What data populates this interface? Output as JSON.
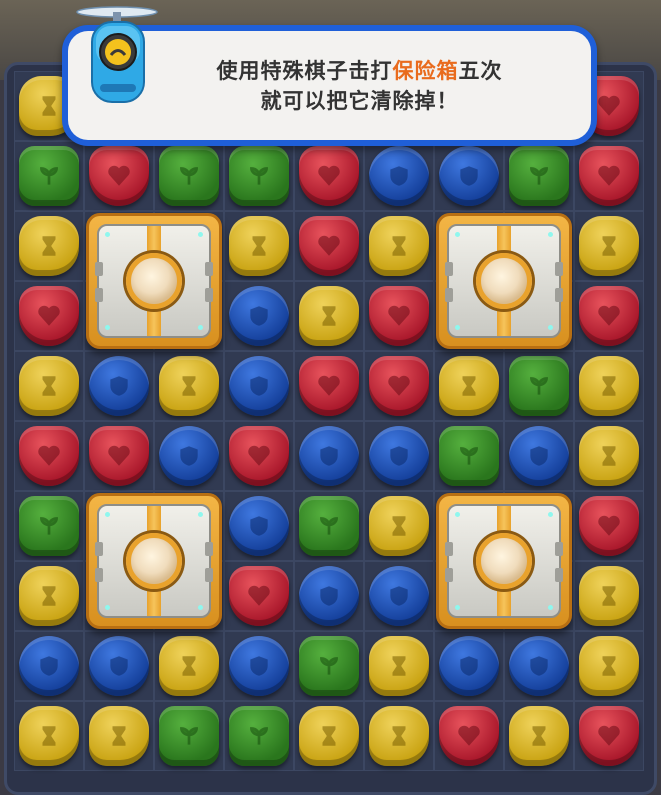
{
  "tooltip": {
    "line1_before": "使用特殊棋子击打",
    "line1_highlight": "保险箱",
    "line1_after": "五次",
    "line2": "就可以把它清除掉！"
  },
  "colors": {
    "highlight": "#e96b1d",
    "banner_border": "#1f5fd8",
    "yellow": "#d7b21e",
    "red": "#c02236",
    "blue": "#1d4fb5",
    "green": "#3a8a2a",
    "safe_frame": "#e8a12b"
  },
  "board": {
    "cols": 9,
    "rows": 10,
    "grid": [
      [
        "Y",
        "R",
        "G",
        "G",
        "G",
        "G",
        "G",
        "G",
        "R"
      ],
      [
        "G",
        "R",
        "G",
        "G",
        "R",
        "B",
        "B",
        "G",
        "R"
      ],
      [
        "Y",
        "S",
        "S",
        "Y",
        "R",
        "Y",
        "S",
        "S",
        "Y"
      ],
      [
        "R",
        "S",
        "S",
        "B",
        "Y",
        "R",
        "S",
        "S",
        "R"
      ],
      [
        "Y",
        "B",
        "Y",
        "B",
        "R",
        "R",
        "Y",
        "G",
        "Y"
      ],
      [
        "R",
        "R",
        "B",
        "R",
        "B",
        "B",
        "G",
        "B",
        "Y"
      ],
      [
        "G",
        "S",
        "S",
        "B",
        "G",
        "Y",
        "S",
        "S",
        "R"
      ],
      [
        "Y",
        "S",
        "S",
        "R",
        "B",
        "B",
        "S",
        "S",
        "Y"
      ],
      [
        "B",
        "B",
        "Y",
        "B",
        "G",
        "Y",
        "B",
        "B",
        "Y"
      ],
      [
        "Y",
        "Y",
        "G",
        "G",
        "Y",
        "Y",
        "R",
        "Y",
        "R"
      ]
    ],
    "tile_icons": {
      "Y": "hourglass-icon",
      "R": "heart-icon",
      "B": "shield-icon",
      "G": "sprout-icon"
    },
    "safes": [
      {
        "name": "safe-top-left",
        "col": 1,
        "row": 2
      },
      {
        "name": "safe-top-right",
        "col": 6,
        "row": 2
      },
      {
        "name": "safe-bottom-left",
        "col": 1,
        "row": 6
      },
      {
        "name": "safe-bottom-right",
        "col": 6,
        "row": 6
      }
    ]
  }
}
